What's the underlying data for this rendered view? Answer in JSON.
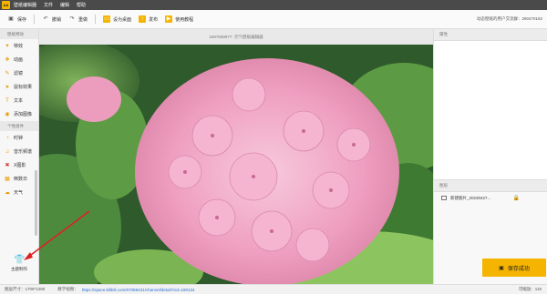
{
  "app": {
    "logo_text": "AA",
    "title": "壁纸编辑器"
  },
  "menu": [
    "文件",
    "编辑",
    "帮助"
  ],
  "toolbar": {
    "save": "保存",
    "undo": "撤销",
    "redo": "重做",
    "set_wallpaper": "设为桌面",
    "publish": "发布",
    "tutorial": "使用教程",
    "right_info": "动态壁纸的用户交流群：290470182"
  },
  "left_sidebar": {
    "section_basic": "壁纸特效",
    "basic_items": [
      "特效",
      "动画",
      "滤镜",
      "鼠标效果",
      "文本",
      "添加图像"
    ],
    "section_custom": "个性组件",
    "custom_items": [
      "时钟",
      "音乐频谱",
      "X图影",
      "倒数日",
      "天气"
    ],
    "theme_label": "主题制作"
  },
  "canvas": {
    "title": "1687659977 -元气壁纸编辑器"
  },
  "right_panel": {
    "properties_title": "属性",
    "layers_title": "图层",
    "layer_name": "新建图片_20230427...",
    "save_button": "保存成功"
  },
  "status": {
    "resolution": "图层尺寸：1706*1280",
    "video_label": "教学视频：",
    "video_link": "https://space.bilibili.com/67088431/channel/detail?cid=180134",
    "zoom": "可缩放：115"
  },
  "colors": {
    "accent": "#f5b400",
    "flower_pink": "#f2a6c6",
    "leaf_green": "#3d6b3a"
  }
}
